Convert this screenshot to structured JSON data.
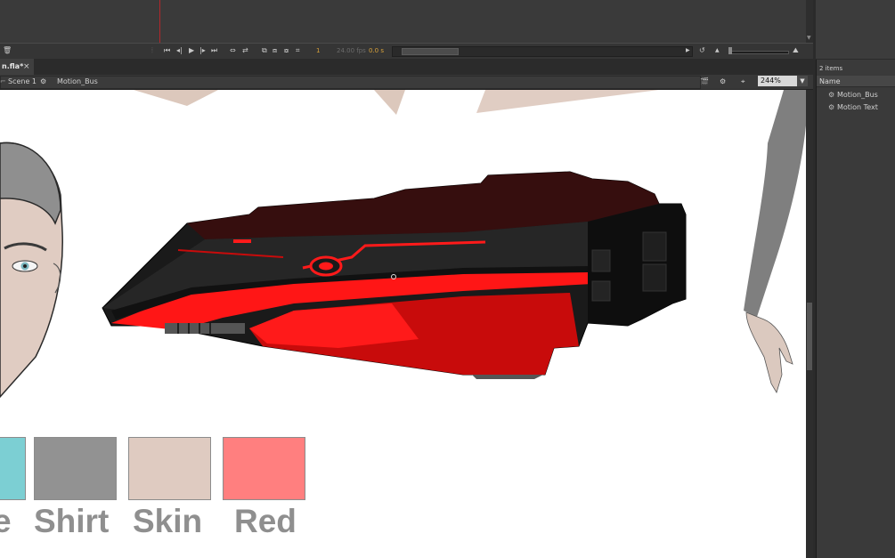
{
  "timeline": {
    "frame_number": "1",
    "fps": "24.00 fps",
    "elapsed_time": "0.0 s"
  },
  "document_tab": {
    "name": "n.fla*",
    "close_glyph": "×"
  },
  "edit_bar": {
    "scene_label": "Scene 1",
    "symbol_label": "Motion_Bus",
    "zoom_value": "244%"
  },
  "library": {
    "item_count": "2 items",
    "column_header": "Name",
    "items": [
      {
        "name": "Motion_Bus",
        "icon": "movieclip-symbol-icon"
      },
      {
        "name": "Motion Text",
        "icon": "movieclip-symbol-icon"
      }
    ]
  },
  "swatches": [
    {
      "label": "e",
      "color": "#7ccfd3"
    },
    {
      "label": "Shirt",
      "color": "#929292"
    },
    {
      "label": "Skin",
      "color": "#dfcbc1"
    },
    {
      "label": "Red",
      "color": "#ff7f7f"
    }
  ],
  "colors": {
    "ui_background": "#3a3a3a",
    "stage": "#ffffff",
    "accent_orange": "#d9a23a",
    "vehicle_red": "#ff1111",
    "vehicle_black": "#1c1c1c"
  }
}
